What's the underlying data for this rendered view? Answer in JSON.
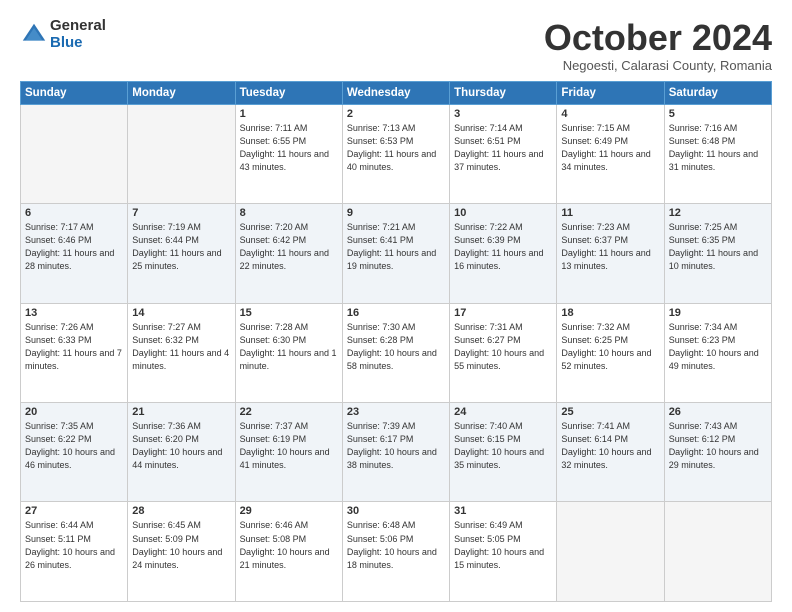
{
  "logo": {
    "general": "General",
    "blue": "Blue"
  },
  "header": {
    "month": "October 2024",
    "subtitle": "Negoesti, Calarasi County, Romania"
  },
  "weekdays": [
    "Sunday",
    "Monday",
    "Tuesday",
    "Wednesday",
    "Thursday",
    "Friday",
    "Saturday"
  ],
  "weeks": [
    [
      {
        "day": "",
        "info": ""
      },
      {
        "day": "",
        "info": ""
      },
      {
        "day": "1",
        "info": "Sunrise: 7:11 AM\nSunset: 6:55 PM\nDaylight: 11 hours and 43 minutes."
      },
      {
        "day": "2",
        "info": "Sunrise: 7:13 AM\nSunset: 6:53 PM\nDaylight: 11 hours and 40 minutes."
      },
      {
        "day": "3",
        "info": "Sunrise: 7:14 AM\nSunset: 6:51 PM\nDaylight: 11 hours and 37 minutes."
      },
      {
        "day": "4",
        "info": "Sunrise: 7:15 AM\nSunset: 6:49 PM\nDaylight: 11 hours and 34 minutes."
      },
      {
        "day": "5",
        "info": "Sunrise: 7:16 AM\nSunset: 6:48 PM\nDaylight: 11 hours and 31 minutes."
      }
    ],
    [
      {
        "day": "6",
        "info": "Sunrise: 7:17 AM\nSunset: 6:46 PM\nDaylight: 11 hours and 28 minutes."
      },
      {
        "day": "7",
        "info": "Sunrise: 7:19 AM\nSunset: 6:44 PM\nDaylight: 11 hours and 25 minutes."
      },
      {
        "day": "8",
        "info": "Sunrise: 7:20 AM\nSunset: 6:42 PM\nDaylight: 11 hours and 22 minutes."
      },
      {
        "day": "9",
        "info": "Sunrise: 7:21 AM\nSunset: 6:41 PM\nDaylight: 11 hours and 19 minutes."
      },
      {
        "day": "10",
        "info": "Sunrise: 7:22 AM\nSunset: 6:39 PM\nDaylight: 11 hours and 16 minutes."
      },
      {
        "day": "11",
        "info": "Sunrise: 7:23 AM\nSunset: 6:37 PM\nDaylight: 11 hours and 13 minutes."
      },
      {
        "day": "12",
        "info": "Sunrise: 7:25 AM\nSunset: 6:35 PM\nDaylight: 11 hours and 10 minutes."
      }
    ],
    [
      {
        "day": "13",
        "info": "Sunrise: 7:26 AM\nSunset: 6:33 PM\nDaylight: 11 hours and 7 minutes."
      },
      {
        "day": "14",
        "info": "Sunrise: 7:27 AM\nSunset: 6:32 PM\nDaylight: 11 hours and 4 minutes."
      },
      {
        "day": "15",
        "info": "Sunrise: 7:28 AM\nSunset: 6:30 PM\nDaylight: 11 hours and 1 minute."
      },
      {
        "day": "16",
        "info": "Sunrise: 7:30 AM\nSunset: 6:28 PM\nDaylight: 10 hours and 58 minutes."
      },
      {
        "day": "17",
        "info": "Sunrise: 7:31 AM\nSunset: 6:27 PM\nDaylight: 10 hours and 55 minutes."
      },
      {
        "day": "18",
        "info": "Sunrise: 7:32 AM\nSunset: 6:25 PM\nDaylight: 10 hours and 52 minutes."
      },
      {
        "day": "19",
        "info": "Sunrise: 7:34 AM\nSunset: 6:23 PM\nDaylight: 10 hours and 49 minutes."
      }
    ],
    [
      {
        "day": "20",
        "info": "Sunrise: 7:35 AM\nSunset: 6:22 PM\nDaylight: 10 hours and 46 minutes."
      },
      {
        "day": "21",
        "info": "Sunrise: 7:36 AM\nSunset: 6:20 PM\nDaylight: 10 hours and 44 minutes."
      },
      {
        "day": "22",
        "info": "Sunrise: 7:37 AM\nSunset: 6:19 PM\nDaylight: 10 hours and 41 minutes."
      },
      {
        "day": "23",
        "info": "Sunrise: 7:39 AM\nSunset: 6:17 PM\nDaylight: 10 hours and 38 minutes."
      },
      {
        "day": "24",
        "info": "Sunrise: 7:40 AM\nSunset: 6:15 PM\nDaylight: 10 hours and 35 minutes."
      },
      {
        "day": "25",
        "info": "Sunrise: 7:41 AM\nSunset: 6:14 PM\nDaylight: 10 hours and 32 minutes."
      },
      {
        "day": "26",
        "info": "Sunrise: 7:43 AM\nSunset: 6:12 PM\nDaylight: 10 hours and 29 minutes."
      }
    ],
    [
      {
        "day": "27",
        "info": "Sunrise: 6:44 AM\nSunset: 5:11 PM\nDaylight: 10 hours and 26 minutes."
      },
      {
        "day": "28",
        "info": "Sunrise: 6:45 AM\nSunset: 5:09 PM\nDaylight: 10 hours and 24 minutes."
      },
      {
        "day": "29",
        "info": "Sunrise: 6:46 AM\nSunset: 5:08 PM\nDaylight: 10 hours and 21 minutes."
      },
      {
        "day": "30",
        "info": "Sunrise: 6:48 AM\nSunset: 5:06 PM\nDaylight: 10 hours and 18 minutes."
      },
      {
        "day": "31",
        "info": "Sunrise: 6:49 AM\nSunset: 5:05 PM\nDaylight: 10 hours and 15 minutes."
      },
      {
        "day": "",
        "info": ""
      },
      {
        "day": "",
        "info": ""
      }
    ]
  ]
}
